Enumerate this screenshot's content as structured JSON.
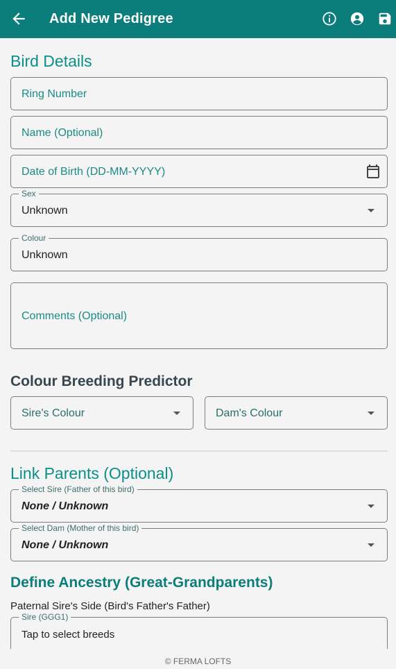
{
  "appbar": {
    "title": "Add New Pedigree",
    "color": "#0b7d7a"
  },
  "bird_details": {
    "title": "Bird Details",
    "ring_number": {
      "placeholder": "Ring Number"
    },
    "name": {
      "placeholder": "Name (Optional)"
    },
    "dob": {
      "placeholder": "Date of Birth (DD-MM-YYYY)"
    },
    "sex": {
      "label": "Sex",
      "value": "Unknown"
    },
    "colour": {
      "label": "Colour",
      "value": "Unknown"
    },
    "comments": {
      "placeholder": "Comments (Optional)"
    }
  },
  "predictor": {
    "title": "Colour Breeding Predictor",
    "sire_colour": "Sire's Colour",
    "dam_colour": "Dam's Colour"
  },
  "link_parents": {
    "title": "Link Parents (Optional)",
    "sire": {
      "label": "Select Sire (Father of this bird)",
      "value": "None / Unknown"
    },
    "dam": {
      "label": "Select Dam (Mother of this bird)",
      "value": "None / Unknown"
    }
  },
  "ancestry": {
    "title": "Define Ancestry (Great-Grandparents)",
    "paternal_sire_side": "Paternal Sire's Side (Bird's Father's Father)",
    "ggg1": {
      "label": "Sire (GGG1)",
      "value": "Tap to select breeds"
    }
  },
  "footer": "© FERMA LOFTS"
}
